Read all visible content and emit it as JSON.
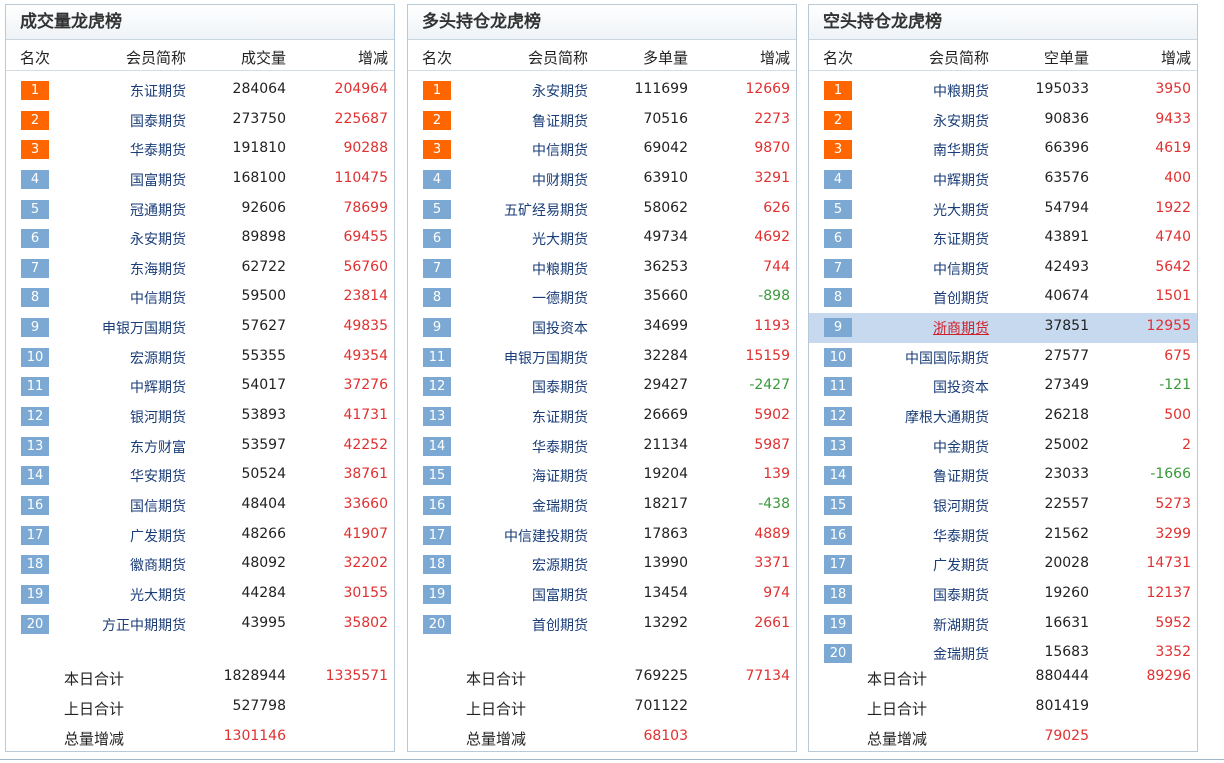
{
  "panels": [
    {
      "title": "成交量龙虎榜",
      "headers": {
        "rank": "名次",
        "name": "会员简称",
        "value": "成交量",
        "change": "增减"
      },
      "rows": [
        {
          "rank": "1",
          "name": "东证期货",
          "value": "284064",
          "change": "204964"
        },
        {
          "rank": "2",
          "name": "国泰期货",
          "value": "273750",
          "change": "225687"
        },
        {
          "rank": "3",
          "name": "华泰期货",
          "value": "191810",
          "change": "90288"
        },
        {
          "rank": "4",
          "name": "国富期货",
          "value": "168100",
          "change": "110475"
        },
        {
          "rank": "5",
          "name": "冠通期货",
          "value": "92606",
          "change": "78699"
        },
        {
          "rank": "6",
          "name": "永安期货",
          "value": "89898",
          "change": "69455"
        },
        {
          "rank": "7",
          "name": "东海期货",
          "value": "62722",
          "change": "56760"
        },
        {
          "rank": "8",
          "name": "中信期货",
          "value": "59500",
          "change": "23814"
        },
        {
          "rank": "9",
          "name": "申银万国期货",
          "value": "57627",
          "change": "49835"
        },
        {
          "rank": "10",
          "name": "宏源期货",
          "value": "55355",
          "change": "49354"
        },
        {
          "rank": "11",
          "name": "中辉期货",
          "value": "54017",
          "change": "37276"
        },
        {
          "rank": "12",
          "name": "银河期货",
          "value": "53893",
          "change": "41731"
        },
        {
          "rank": "13",
          "name": "东方财富",
          "value": "53597",
          "change": "42252"
        },
        {
          "rank": "14",
          "name": "华安期货",
          "value": "50524",
          "change": "38761"
        },
        {
          "rank": "16",
          "name": "国信期货",
          "value": "48404",
          "change": "33660"
        },
        {
          "rank": "17",
          "name": "广发期货",
          "value": "48266",
          "change": "41907"
        },
        {
          "rank": "18",
          "name": "徽商期货",
          "value": "48092",
          "change": "32202"
        },
        {
          "rank": "19",
          "name": "光大期货",
          "value": "44284",
          "change": "30155"
        },
        {
          "rank": "20",
          "name": "方正中期期货",
          "value": "43995",
          "change": "35802"
        }
      ],
      "summary": [
        {
          "label": "本日合计",
          "value": "1828944",
          "change": "1335571"
        },
        {
          "label": "上日合计",
          "value": "527798",
          "change": ""
        },
        {
          "label": "总量增减",
          "value": "",
          "change": "1301146"
        }
      ]
    },
    {
      "title": "多头持仓龙虎榜",
      "headers": {
        "rank": "名次",
        "name": "会员简称",
        "value": "多单量",
        "change": "增减"
      },
      "rows": [
        {
          "rank": "1",
          "name": "永安期货",
          "value": "111699",
          "change": "12669"
        },
        {
          "rank": "2",
          "name": "鲁证期货",
          "value": "70516",
          "change": "2273"
        },
        {
          "rank": "3",
          "name": "中信期货",
          "value": "69042",
          "change": "9870"
        },
        {
          "rank": "4",
          "name": "中财期货",
          "value": "63910",
          "change": "3291"
        },
        {
          "rank": "5",
          "name": "五矿经易期货",
          "value": "58062",
          "change": "626"
        },
        {
          "rank": "6",
          "name": "光大期货",
          "value": "49734",
          "change": "4692"
        },
        {
          "rank": "7",
          "name": "中粮期货",
          "value": "36253",
          "change": "744"
        },
        {
          "rank": "8",
          "name": "一德期货",
          "value": "35660",
          "change": "-898"
        },
        {
          "rank": "9",
          "name": "国投资本",
          "value": "34699",
          "change": "1193"
        },
        {
          "rank": "11",
          "name": "申银万国期货",
          "value": "32284",
          "change": "15159"
        },
        {
          "rank": "12",
          "name": "国泰期货",
          "value": "29427",
          "change": "-2427"
        },
        {
          "rank": "13",
          "name": "东证期货",
          "value": "26669",
          "change": "5902"
        },
        {
          "rank": "14",
          "name": "华泰期货",
          "value": "21134",
          "change": "5987"
        },
        {
          "rank": "15",
          "name": "海证期货",
          "value": "19204",
          "change": "139"
        },
        {
          "rank": "16",
          "name": "金瑞期货",
          "value": "18217",
          "change": "-438"
        },
        {
          "rank": "17",
          "name": "中信建投期货",
          "value": "17863",
          "change": "4889"
        },
        {
          "rank": "18",
          "name": "宏源期货",
          "value": "13990",
          "change": "3371"
        },
        {
          "rank": "19",
          "name": "国富期货",
          "value": "13454",
          "change": "974"
        },
        {
          "rank": "20",
          "name": "首创期货",
          "value": "13292",
          "change": "2661"
        }
      ],
      "summary": [
        {
          "label": "本日合计",
          "value": "769225",
          "change": "77134"
        },
        {
          "label": "上日合计",
          "value": "701122",
          "change": ""
        },
        {
          "label": "总量增减",
          "value": "",
          "change": "68103"
        }
      ]
    },
    {
      "title": "空头持仓龙虎榜",
      "headers": {
        "rank": "名次",
        "name": "会员简称",
        "value": "空单量",
        "change": "增减"
      },
      "rows": [
        {
          "rank": "1",
          "name": "中粮期货",
          "value": "195033",
          "change": "3950"
        },
        {
          "rank": "2",
          "name": "永安期货",
          "value": "90836",
          "change": "9433"
        },
        {
          "rank": "3",
          "name": "南华期货",
          "value": "66396",
          "change": "4619"
        },
        {
          "rank": "4",
          "name": "中辉期货",
          "value": "63576",
          "change": "400"
        },
        {
          "rank": "5",
          "name": "光大期货",
          "value": "54794",
          "change": "1922"
        },
        {
          "rank": "6",
          "name": "东证期货",
          "value": "43891",
          "change": "4740"
        },
        {
          "rank": "7",
          "name": "中信期货",
          "value": "42493",
          "change": "5642"
        },
        {
          "rank": "8",
          "name": "首创期货",
          "value": "40674",
          "change": "1501"
        },
        {
          "rank": "9",
          "name": "浙商期货",
          "value": "37851",
          "change": "12955"
        },
        {
          "rank": "10",
          "name": "中国国际期货",
          "value": "27577",
          "change": "675"
        },
        {
          "rank": "11",
          "name": "国投资本",
          "value": "27349",
          "change": "-121"
        },
        {
          "rank": "12",
          "name": "摩根大通期货",
          "value": "26218",
          "change": "500"
        },
        {
          "rank": "13",
          "name": "中金期货",
          "value": "25002",
          "change": "2"
        },
        {
          "rank": "14",
          "name": "鲁证期货",
          "value": "23033",
          "change": "-1666"
        },
        {
          "rank": "15",
          "name": "银河期货",
          "value": "22557",
          "change": "5273"
        },
        {
          "rank": "16",
          "name": "华泰期货",
          "value": "21562",
          "change": "3299"
        },
        {
          "rank": "17",
          "name": "广发期货",
          "value": "20028",
          "change": "14731"
        },
        {
          "rank": "18",
          "name": "国泰期货",
          "value": "19260",
          "change": "12137"
        },
        {
          "rank": "19",
          "name": "新湖期货",
          "value": "16631",
          "change": "5952"
        },
        {
          "rank": "20",
          "name": "金瑞期货",
          "value": "15683",
          "change": "3352"
        }
      ],
      "summary": [
        {
          "label": "本日合计",
          "value": "880444",
          "change": "89296"
        },
        {
          "label": "上日合计",
          "value": "801419",
          "change": ""
        },
        {
          "label": "总量增减",
          "value": "",
          "change": "79025"
        }
      ]
    }
  ],
  "highlight": {
    "panel": 2,
    "row": 8
  },
  "colors": {
    "top_rank": "#ff6600",
    "rank": "#7ba9d3",
    "positive": "#e03030",
    "negative": "#3a9a3a",
    "name": "#1a3d78",
    "highlight_row": "#c7d9ee"
  }
}
